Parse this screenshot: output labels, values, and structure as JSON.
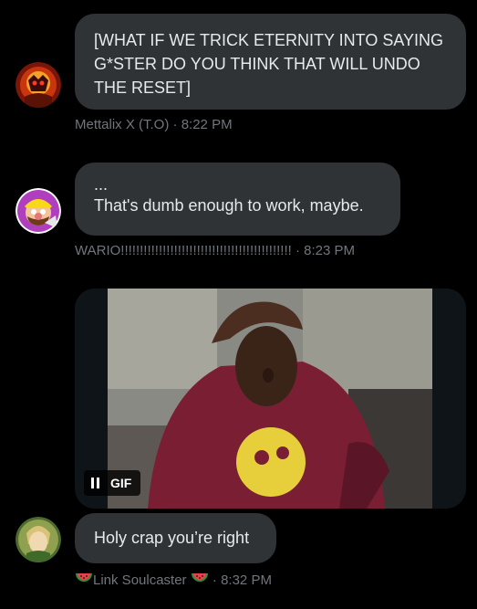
{
  "messages": [
    {
      "author_avatar": "avatar-mettalix",
      "text": "[WHAT IF WE TRICK ETERNITY INTO SAYING G*STER DO YOU THINK THAT WILL UNDO THE RESET]",
      "author": "Mettalix X (T.O)",
      "time": "8:22 PM"
    },
    {
      "author_avatar": "avatar-wario",
      "line1": "...",
      "line2": "That's dumb enough to work, maybe.",
      "author": "WARIO!!!!!!!!!!!!!!!!!!!!!!!!!!!!!!!!!!!!!!!!!!!!!",
      "time": "8:23 PM"
    },
    {
      "media": {
        "badge": "GIF",
        "icon": "pause-icon"
      }
    },
    {
      "author_avatar": "avatar-link",
      "text": "Holy crap you’re right",
      "author": "Link Soulcaster",
      "author_icons": [
        "watermelon-icon",
        "watermelon-icon"
      ],
      "time": "8:32 PM"
    }
  ],
  "separator": "·",
  "colors": {
    "background": "#000000",
    "bubble": "#2f3336",
    "text": "#e7e9ea",
    "meta": "#71767b"
  }
}
